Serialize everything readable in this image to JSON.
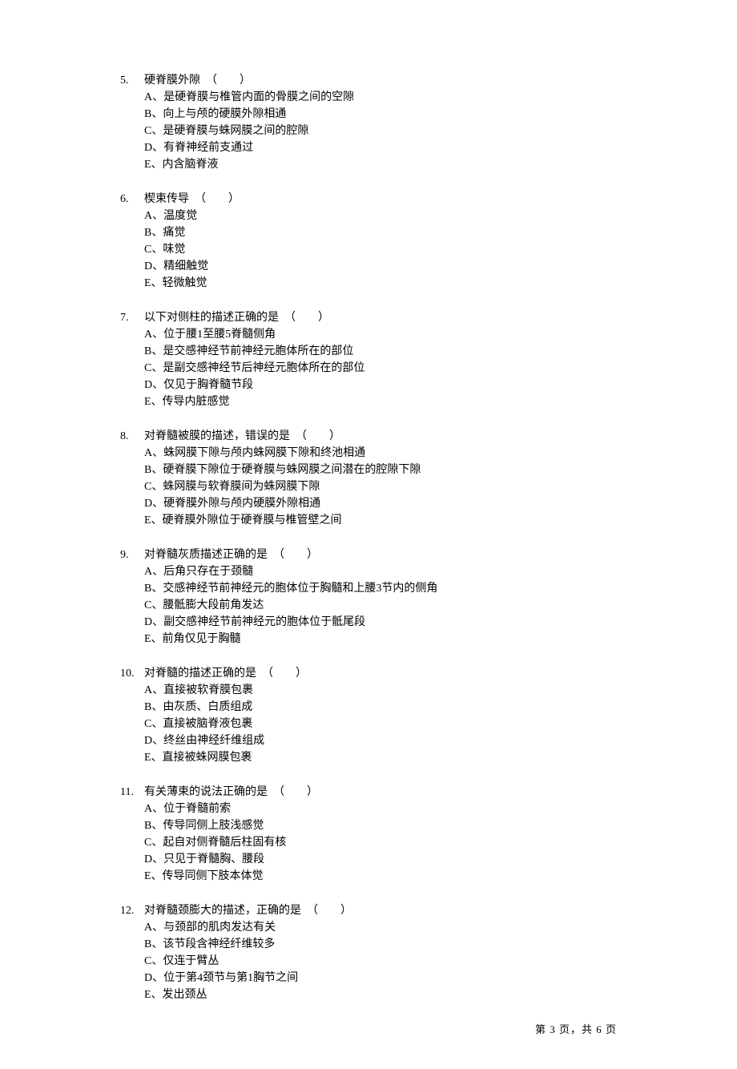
{
  "questions": [
    {
      "num": "5.",
      "stem": "硬脊膜外隙　（　　）",
      "opts": [
        "A、是硬脊膜与椎管内面的骨膜之间的空隙",
        "B、向上与颅的硬膜外隙相通",
        "C、是硬脊膜与蛛网膜之间的腔隙",
        "D、有脊神经前支通过",
        "E、内含脑脊液"
      ]
    },
    {
      "num": "6.",
      "stem": "楔束传导　（　　）",
      "opts": [
        "A、温度觉",
        "B、痛觉",
        "C、味觉",
        "D、精细触觉",
        "E、轻微触觉"
      ]
    },
    {
      "num": "7.",
      "stem": "以下对侧柱的描述正确的是　（　　）",
      "opts": [
        "A、位于腰1至腰5脊髓侧角",
        "B、是交感神经节前神经元胞体所在的部位",
        "C、是副交感神经节后神经元胞体所在的部位",
        "D、仅见于胸脊髓节段",
        "E、传导内脏感觉"
      ]
    },
    {
      "num": "8.",
      "stem": "对脊髓被膜的描述，错误的是　（　　）",
      "opts": [
        "A、蛛网膜下隙与颅内蛛网膜下隙和终池相通",
        "B、硬脊膜下隙位于硬脊膜与蛛网膜之间潜在的腔隙下隙",
        "C、蛛网膜与软脊膜间为蛛网膜下隙",
        "D、硬脊膜外隙与颅内硬膜外隙相通",
        "E、硬脊膜外隙位于硬脊膜与椎管壁之间"
      ]
    },
    {
      "num": "9.",
      "stem": "对脊髓灰质描述正确的是　（　　）",
      "opts": [
        "A、后角只存在于颈髓",
        "B、交感神经节前神经元的胞体位于胸髓和上腰3节内的侧角",
        "C、腰骶膨大段前角发达",
        "D、副交感神经节前神经元的胞体位于骶尾段",
        "E、前角仅见于胸髓"
      ]
    },
    {
      "num": "10.",
      "stem": "对脊髓的描述正确的是　（　　）",
      "opts": [
        "A、直接被软脊膜包裹",
        "B、由灰质、白质组成",
        "C、直接被脑脊液包裹",
        "D、终丝由神经纤维组成",
        "E、直接被蛛网膜包裹"
      ]
    },
    {
      "num": "11.",
      "stem": "有关薄束的说法正确的是　（　　）",
      "opts": [
        "A、位于脊髓前索",
        "B、传导同侧上肢浅感觉",
        "C、起自对侧脊髓后柱固有核",
        "D、只见于脊髓胸、腰段",
        "E、传导同侧下肢本体觉"
      ]
    },
    {
      "num": "12.",
      "stem": "对脊髓颈膨大的描述，正确的是　（　　）",
      "opts": [
        "A、与颈部的肌肉发达有关",
        "B、该节段含神经纤维较多",
        "C、仅连于臂丛",
        "D、位于第4颈节与第1胸节之间",
        "E、发出颈丛"
      ]
    }
  ],
  "footer": "第 3 页，共 6 页"
}
